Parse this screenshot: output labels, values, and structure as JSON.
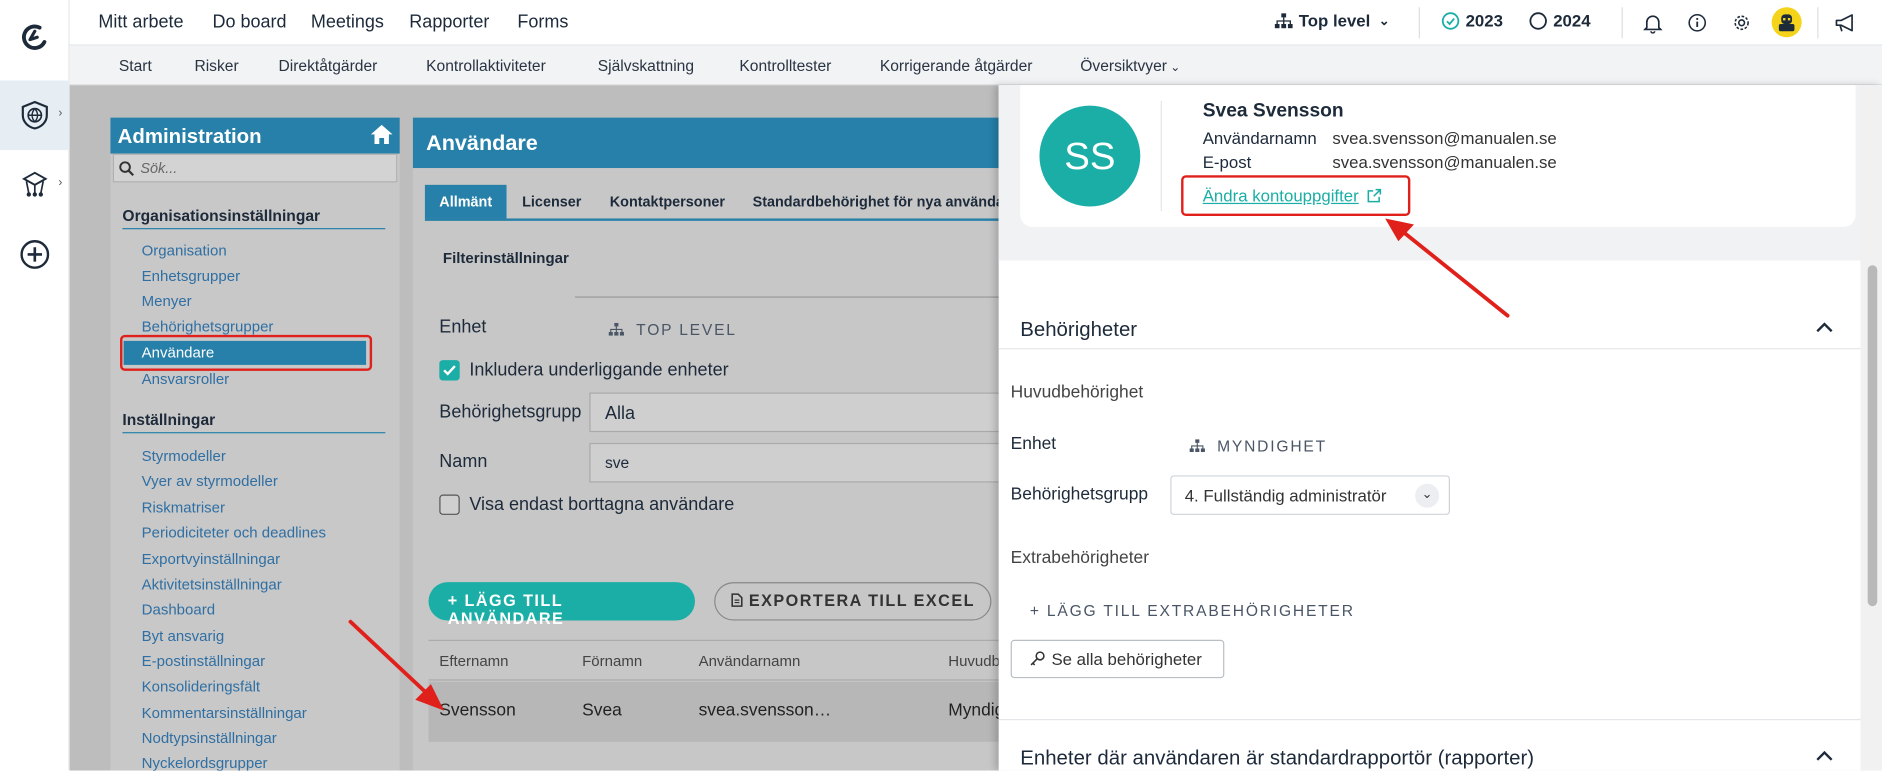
{
  "topnav": {
    "items": [
      "Mitt arbete",
      "Do board",
      "Meetings",
      "Rapporter",
      "Forms"
    ],
    "unit": "Top level",
    "year_active": "2023",
    "year_inactive": "2024"
  },
  "subnav": {
    "items": [
      "Start",
      "Risker",
      "Direktåtgärder",
      "Kontrollaktiviteter",
      "Självskattning",
      "Kontrolltester",
      "Korrigerande åtgärder",
      "Översiktvyer"
    ]
  },
  "admin": {
    "title": "Administration",
    "search_placeholder": "Sök...",
    "section1_title": "Organisationsinställningar",
    "section1_links": [
      "Organisation",
      "Enhetsgrupper",
      "Menyer",
      "Behörighetsgrupper",
      "Användare",
      "Ansvarsroller"
    ],
    "section2_title": "Inställningar",
    "section2_links": [
      "Styrmodeller",
      "Vyer av styrmodeller",
      "Riskmatriser",
      "Periodiciteter och deadlines",
      "Exportvyinställningar",
      "Aktivitetsinställningar",
      "Dashboard",
      "Byt ansvarig",
      "E-postinställningar",
      "Konsolideringsfält",
      "Kommentarsinställningar",
      "Nodtypsinställningar",
      "Nyckelordsgrupper"
    ]
  },
  "users": {
    "title": "Användare",
    "tabs": [
      "Allmänt",
      "Licenser",
      "Kontaktpersoner",
      "Standardbehörighet för nya användare"
    ],
    "filter_title": "Filterinställningar",
    "unit_label": "Enhet",
    "unit_value": "TOP LEVEL",
    "include_sub": "Inkludera underliggande enheter",
    "group_label": "Behörighetsgrupp",
    "group_value": "Alla",
    "name_label": "Namn",
    "name_value": "sve",
    "show_deleted": "Visa endast borttagna användare",
    "add_btn": "+ LÄGG TILL ANVÄNDARE",
    "export_btn": "EXPORTERA TILL EXCEL",
    "table": {
      "headers": [
        "Efternamn",
        "Förnamn",
        "Användarnamn",
        "Huvudb"
      ],
      "rows": [
        [
          "Svensson",
          "Svea",
          "svea.svensson…",
          "Myndig"
        ]
      ]
    }
  },
  "drawer": {
    "initials": "SS",
    "avatar_color": "#1aaea6",
    "full_name": "Svea Svensson",
    "username_label": "Användarnamn",
    "username_value": "svea.svensson@manualen.se",
    "email_label": "E-post",
    "email_value": "svea.svensson@manualen.se",
    "edit_link": "Ändra kontouppgifter",
    "perm_title": "Behörigheter",
    "main_perm": "Huvudbehörighet",
    "unit_label": "Enhet",
    "unit_value": "MYNDIGHET",
    "group_label": "Behörighetsgrupp",
    "group_value": "4. Fullständig administratör",
    "extra_title": "Extrabehörigheter",
    "add_extra": "+ LÄGG TILL EXTRABEHÖRIGHETER",
    "see_all": "Se alla behörigheter",
    "units_title": "Enheter där användaren är standardrapportör (rapporter)"
  },
  "colors": {
    "brand": "#2680a9",
    "teal": "#1aaea6",
    "highlight": "#e0201b"
  }
}
